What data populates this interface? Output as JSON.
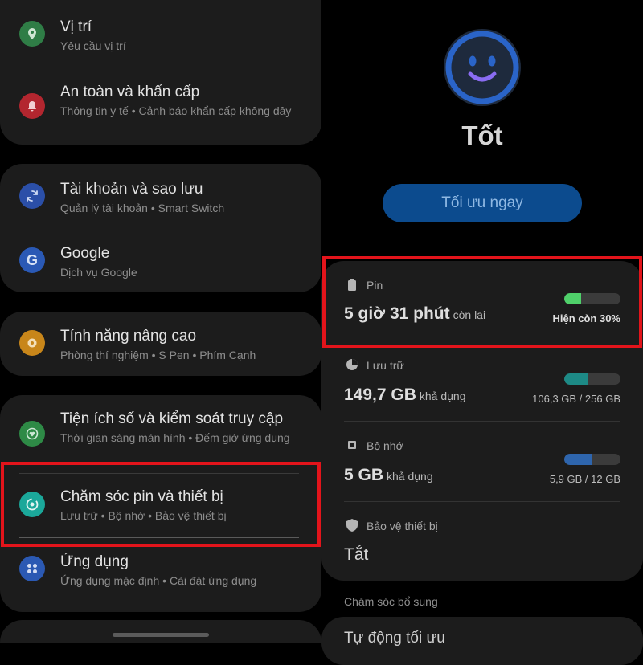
{
  "settings": {
    "items": [
      {
        "title": "Vị trí",
        "subtitle": "Yêu cầu vị trí",
        "icon": "location-pin-icon",
        "color": "#2f7d46"
      },
      {
        "title": "An toàn và khẩn cấp",
        "subtitle": "Thông tin y tế • Cảnh báo khẩn cấp không dây",
        "icon": "alert-bell-icon",
        "color": "#b3262f"
      },
      {
        "title": "Tài khoản và sao lưu",
        "subtitle": "Quản lý tài khoản • Smart Switch",
        "icon": "sync-icon",
        "color": "#2b4fa8"
      },
      {
        "title": "Google",
        "subtitle": "Dịch vụ Google",
        "icon": "google-icon",
        "color": "#2a59b5"
      },
      {
        "title": "Tính năng nâng cao",
        "subtitle": "Phòng thí nghiệm • S Pen • Phím Cạnh",
        "icon": "gear-plus-icon",
        "color": "#c8861a"
      },
      {
        "title": "Tiện ích số và kiểm soát truy cập",
        "subtitle": "Thời gian sáng màn hình • Đếm giờ ứng dụng",
        "icon": "heart-circle-icon",
        "color": "#2e8a46"
      },
      {
        "title": "Chăm sóc pin và thiết bị",
        "subtitle": "Lưu trữ • Bộ nhớ • Bảo vệ thiết bị",
        "icon": "device-care-icon",
        "color": "#1ba89a"
      },
      {
        "title": "Ứng dụng",
        "subtitle": "Ứng dụng mặc định • Cài đặt ứng dụng",
        "icon": "apps-grid-icon",
        "color": "#2b59b3"
      }
    ]
  },
  "device_care": {
    "status": "Tốt",
    "optimize_button": "Tối ưu ngay",
    "battery": {
      "label": "Pin",
      "time": "5 giờ 31 phút",
      "suffix": "còn lại",
      "level_text": "Hiện còn 30%",
      "level": 0.3,
      "color": "#4fd06a"
    },
    "storage": {
      "label": "Lưu trữ",
      "value": "149,7 GB",
      "suffix": "khả dụng",
      "usage": "106,3 GB / 256 GB",
      "fraction": 0.415,
      "color": "#1d8a86"
    },
    "memory": {
      "label": "Bộ nhớ",
      "value": "5 GB",
      "suffix": "khả dụng",
      "usage": "5,9 GB / 12 GB",
      "fraction": 0.49,
      "color": "#2e65ad"
    },
    "protection": {
      "label": "Bảo vệ thiết bị",
      "value": "Tắt"
    },
    "extra_label": "Chăm sóc bổ sung",
    "auto_optimize": "Tự động tối ưu"
  },
  "colors": {
    "highlight": "#e3141b",
    "face_ring": "#2a64c8",
    "face_fill": "#1e2a3d",
    "smile": "#8a6cf2"
  }
}
